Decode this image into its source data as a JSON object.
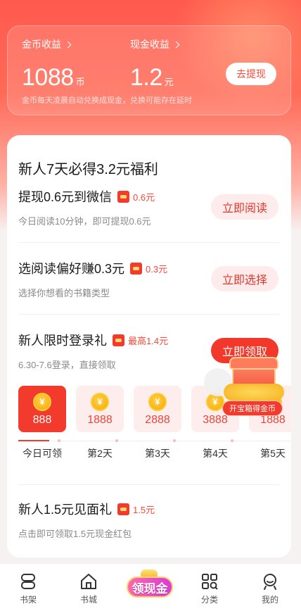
{
  "earnings": {
    "coin_label": "金币收益",
    "coin_value": "1088",
    "coin_unit": "币",
    "cash_label": "现金收益",
    "cash_value": "1.2",
    "cash_unit": "元",
    "withdraw_button": "去提现",
    "note": "金币每天凌晨自动兑换成现金，兑换可能存在延时"
  },
  "welfare": {
    "title": "新人7天必得3.2元福利",
    "tasks": [
      {
        "title": "提现0.6元到微信",
        "reward": "0.6元",
        "subtitle": "今日阅读10分钟，即可提现0.6元",
        "button": "立即阅读",
        "button_style": "light"
      },
      {
        "title": "选阅读偏好赚0.3元",
        "reward": "0.3元",
        "subtitle": "选择你想看的书籍类型",
        "button": "立即选择",
        "button_style": "light"
      },
      {
        "title": "新人限时登录礼",
        "reward": "最高1.4元",
        "subtitle": "6.30-7.6登录，直接领取",
        "button": "立即领取",
        "button_style": "solid"
      }
    ],
    "days": [
      {
        "amount": "888",
        "label": "今日可领",
        "active": true
      },
      {
        "amount": "1888",
        "label": "第2天",
        "active": false
      },
      {
        "amount": "2888",
        "label": "第3天",
        "active": false
      },
      {
        "amount": "3888",
        "label": "第4天",
        "active": false
      },
      {
        "amount": "1888",
        "label": "第5天",
        "active": false
      }
    ],
    "gift": {
      "title": "新人1.5元见面礼",
      "reward": "1.5元",
      "subtitle": "点击即可领取1.5元现金红包"
    },
    "chest_label": "开宝箱得金币"
  },
  "tabbar": {
    "items": [
      {
        "label": "书架",
        "icon": "bookshelf-icon"
      },
      {
        "label": "书城",
        "icon": "home-icon"
      },
      {
        "label": "领现金",
        "icon": "cash-bubble-icon"
      },
      {
        "label": "分类",
        "icon": "category-icon"
      },
      {
        "label": "我的",
        "icon": "profile-icon"
      }
    ]
  },
  "colors": {
    "accent": "#f23a2d",
    "light_accent": "#fdeceb",
    "header_gradient_top": "#ff5a4d"
  }
}
